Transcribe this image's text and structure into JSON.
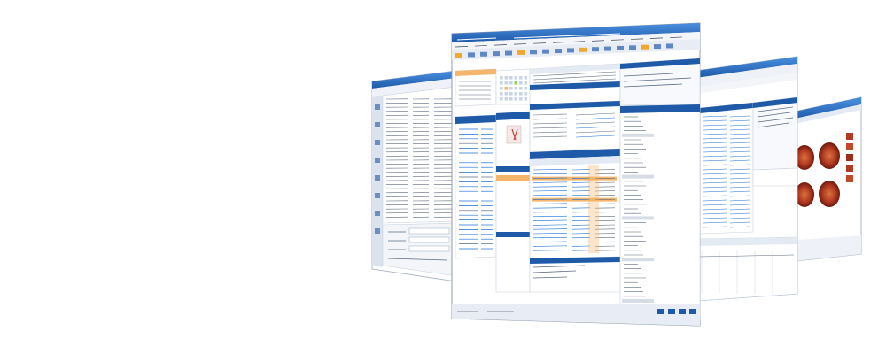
{
  "scene": {
    "description_visible_text": "",
    "windows": [
      {
        "id": "list-window",
        "accent": "#2a5fa8"
      },
      {
        "id": "main-window",
        "accent": "#1e5aa8"
      },
      {
        "id": "records-window",
        "accent": "#2a5fa8"
      },
      {
        "id": "image-window",
        "accent": "#2a5fa8"
      }
    ],
    "colors": {
      "titlebar": "#1e5aa8",
      "titlebar_light": "#3b7fd0",
      "panel": "#eef2f8",
      "grid_line": "#d6dde8",
      "text_blue": "#1a6fd8",
      "selection_orange": "#f5b66b",
      "retina_dark": "#7a1d0f",
      "retina_mid": "#b33a22",
      "retina_light": "#d8743c"
    }
  }
}
